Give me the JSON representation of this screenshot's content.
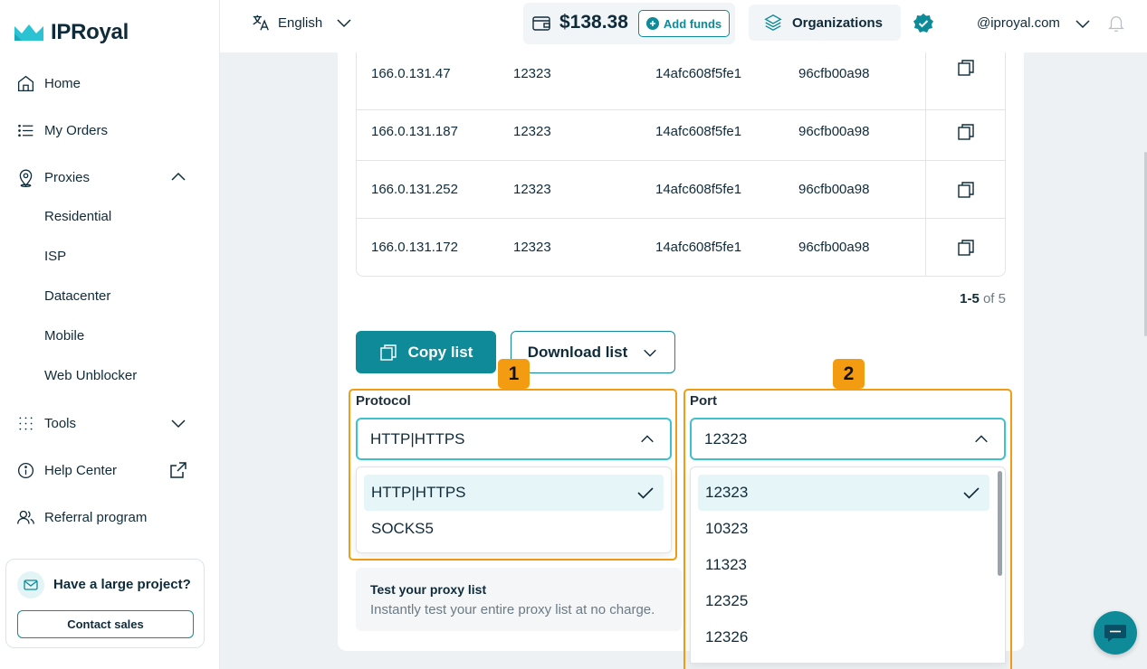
{
  "brand": {
    "name": "IPRoyal"
  },
  "sidebar": {
    "items": [
      {
        "label": "Home",
        "icon": "home-icon"
      },
      {
        "label": "My Orders",
        "icon": "list-icon"
      },
      {
        "label": "Proxies",
        "icon": "location-pin-icon",
        "expanded": true,
        "children": [
          "Residential",
          "ISP",
          "Datacenter",
          "Mobile",
          "Web Unblocker"
        ]
      },
      {
        "label": "Tools",
        "icon": "grid-dots-icon",
        "expanded": false
      },
      {
        "label": "Help Center",
        "icon": "info-icon"
      },
      {
        "label": "Referral program",
        "icon": "users-icon"
      }
    ],
    "promo": {
      "title": "Have a large project?",
      "button": "Contact sales"
    }
  },
  "topbar": {
    "language": "English",
    "balance": "$138.38",
    "add_funds": "Add funds",
    "organizations": "Organizations",
    "user": "@iproyal.com"
  },
  "table": {
    "rows": [
      {
        "ip": "166.0.131.47",
        "port": "12323",
        "user": "14afc608f5fe1",
        "pass": "96cfb00a98"
      },
      {
        "ip": "166.0.131.187",
        "port": "12323",
        "user": "14afc608f5fe1",
        "pass": "96cfb00a98"
      },
      {
        "ip": "166.0.131.252",
        "port": "12323",
        "user": "14afc608f5fe1",
        "pass": "96cfb00a98"
      },
      {
        "ip": "166.0.131.172",
        "port": "12323",
        "user": "14afc608f5fe1",
        "pass": "96cfb00a98"
      }
    ],
    "pager_range": "1-5",
    "pager_total": "of 5"
  },
  "actions": {
    "copy_list": "Copy list",
    "download_list": "Download list"
  },
  "protocol": {
    "badge": "1",
    "label": "Protocol",
    "value": "HTTP|HTTPS",
    "options": [
      "HTTP|HTTPS",
      "SOCKS5"
    ],
    "selected_index": 0
  },
  "port": {
    "badge": "2",
    "label": "Port",
    "value": "12323",
    "options": [
      "12323",
      "10323",
      "11323",
      "12325",
      "12326"
    ],
    "selected_index": 0
  },
  "test": {
    "title": "Test your proxy list",
    "subtitle": "Instantly test your entire proxy list at no charge."
  },
  "colors": {
    "accent": "#0e8a99",
    "highlight": "#f39c12",
    "focus": "#3cc1cf"
  }
}
